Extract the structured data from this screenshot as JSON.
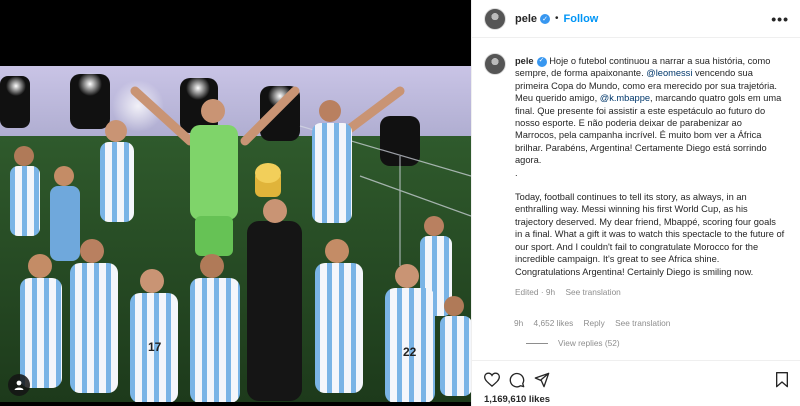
{
  "post": {
    "username": "pele",
    "follow_label": "Follow",
    "more_label": "•••",
    "caption": {
      "username": "pele",
      "pt_part1": "Hoje o futebol continuou a narrar a sua história, como sempre, de forma apaixonante. ",
      "mention1": "@leomessi",
      "pt_part2": " vencendo sua primeira Copa do Mundo, como era merecido por sua trajetória. Meu querido amigo, ",
      "mention2": "@k.mbappe",
      "pt_part3": ", marcando quatro gols em uma final. Que presente foi assistir a este espetáculo ao futuro do nosso esporte. E não poderia deixar de parabenizar ao Marrocos, pela campanha incrível. É muito bom ver a África brilhar. Parabéns, Argentina! Certamente Diego está sorrindo agora.",
      "period": ".",
      "en_text": "Today, football continues to tell its story, as always, in an enthralling way. Messi winning his first World Cup, as his trajectory deserved. My dear friend, Mbappé, scoring four goals in a final. What a gift it was to watch this spectacle to the future of our sport. And I couldn't fail to congratulate Morocco for the incredible campaign. It's great to see Africa shine. Congratulations Argentina! Certainly Diego is smiling now."
    },
    "caption_meta": {
      "edited": "Edited · 9h",
      "see_translation": "See translation"
    },
    "comment_meta": {
      "time": "9h",
      "likes": "4,652 likes",
      "reply": "Reply",
      "see_translation": "See translation"
    },
    "view_replies": "View replies (52)",
    "likes_count": "1,169,610 likes"
  },
  "colors": {
    "link": "#0095f6",
    "mention": "#00376b",
    "muted": "#8e8e8e",
    "verified": "#3897f0"
  },
  "icons": {
    "like": "heart-icon",
    "comment": "comment-icon",
    "share": "paper-plane-icon",
    "save": "bookmark-icon",
    "tagged": "user-tag-icon",
    "verified": "verified-badge-icon"
  }
}
